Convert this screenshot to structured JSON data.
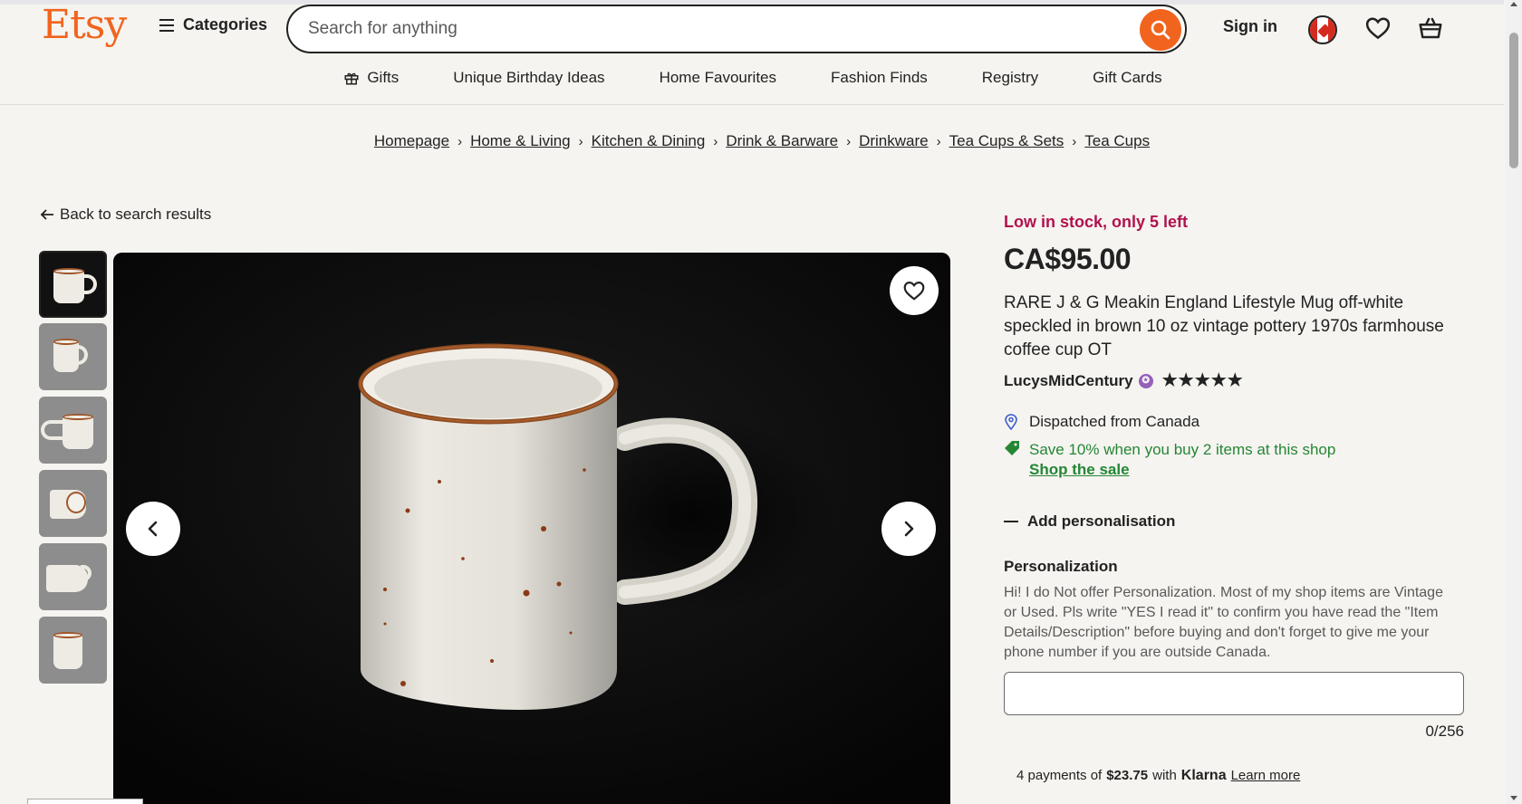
{
  "header": {
    "logo": "Etsy",
    "categories_label": "Categories",
    "search_placeholder": "Search for anything",
    "signin_label": "Sign in"
  },
  "subnav": {
    "items": [
      "Gifts",
      "Unique Birthday Ideas",
      "Home Favourites",
      "Fashion Finds",
      "Registry",
      "Gift Cards"
    ]
  },
  "breadcrumb": [
    "Homepage",
    "Home & Living",
    "Kitchen & Dining",
    "Drink & Barware",
    "Drinkware",
    "Tea Cups & Sets",
    "Tea Cups"
  ],
  "back_label": "Back to search results",
  "gallery": {
    "thumbnail_count": 6,
    "active_index": 0
  },
  "listing": {
    "stock_text": "Low in stock, only 5 left",
    "price": "CA$95.00",
    "title": "RARE J & G Meakin England Lifestyle Mug off-white speckled in brown 10 oz vintage pottery 1970s farmhouse coffee cup OT",
    "shop_name": "LucysMidCentury",
    "rating_stars": "★★★★★",
    "dispatch_text": "Dispatched from Canada",
    "save_text": "Save 10% when you buy 2 items at this shop",
    "shop_sale_link": "Shop the sale",
    "add_personalisation": "Add personalisation",
    "personalization_label": "Personalization",
    "personalization_desc": "Hi! I do Not offer Personalization. Most of my shop items are Vintage or Used. Pls write \"YES I read it\" to confirm you have read the \"Item Details/Description\" before buying and don't forget to give me your phone number if you are outside Canada.",
    "personalization_value": "",
    "char_counter": "0/256",
    "klarna": {
      "prefix": "4 payments of",
      "amount": "$23.75",
      "with": "with",
      "brand": "Klarna",
      "link": "Learn more"
    }
  },
  "colors": {
    "brand": "#f1641e",
    "stock_alert": "#b3114e",
    "promo_green": "#258635",
    "star_seller": "#9560b8"
  }
}
